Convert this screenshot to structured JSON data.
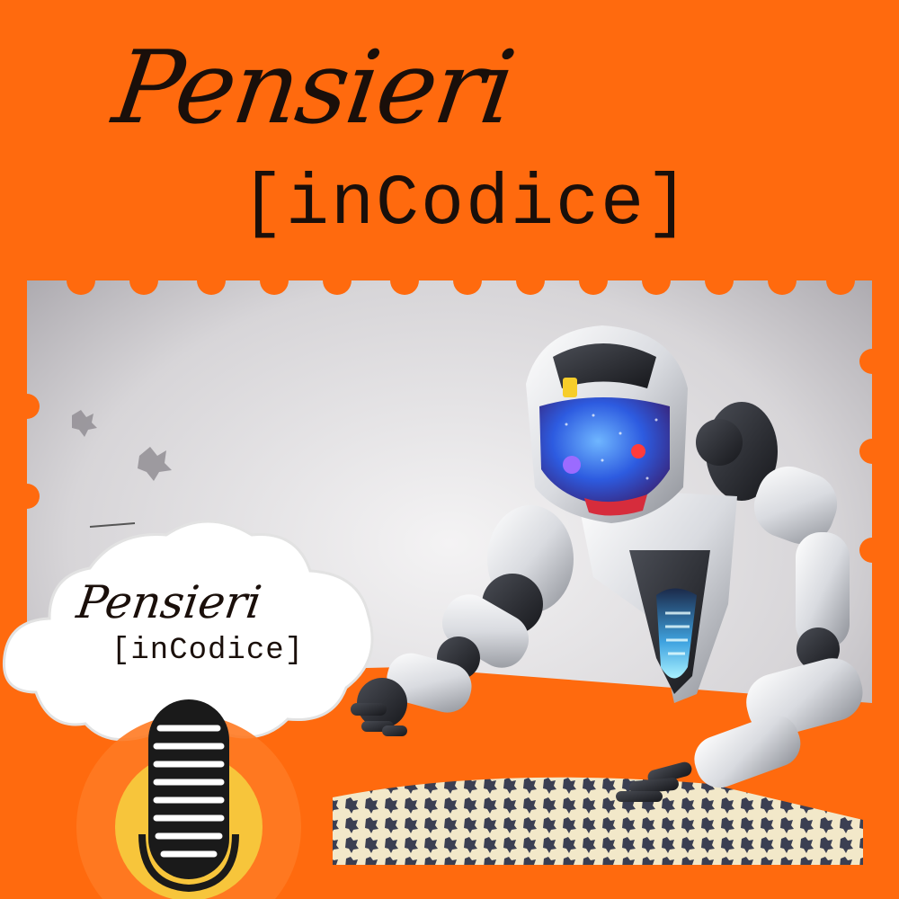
{
  "title": {
    "script": "Pensieri",
    "code": "[inCodice]"
  },
  "badge": {
    "script": "Pensieri",
    "code": "[inCodice]"
  },
  "icons": {
    "robot": "robot-icon",
    "microphone": "microphone-icon",
    "cloud": "cloud-shape",
    "puzzle": "puzzle-pieces"
  },
  "colors": {
    "background": "#ff6a0e",
    "text": "#1a0f0a",
    "mic_yellow": "#f7c53b",
    "robot_visor": "#2d5be0"
  }
}
